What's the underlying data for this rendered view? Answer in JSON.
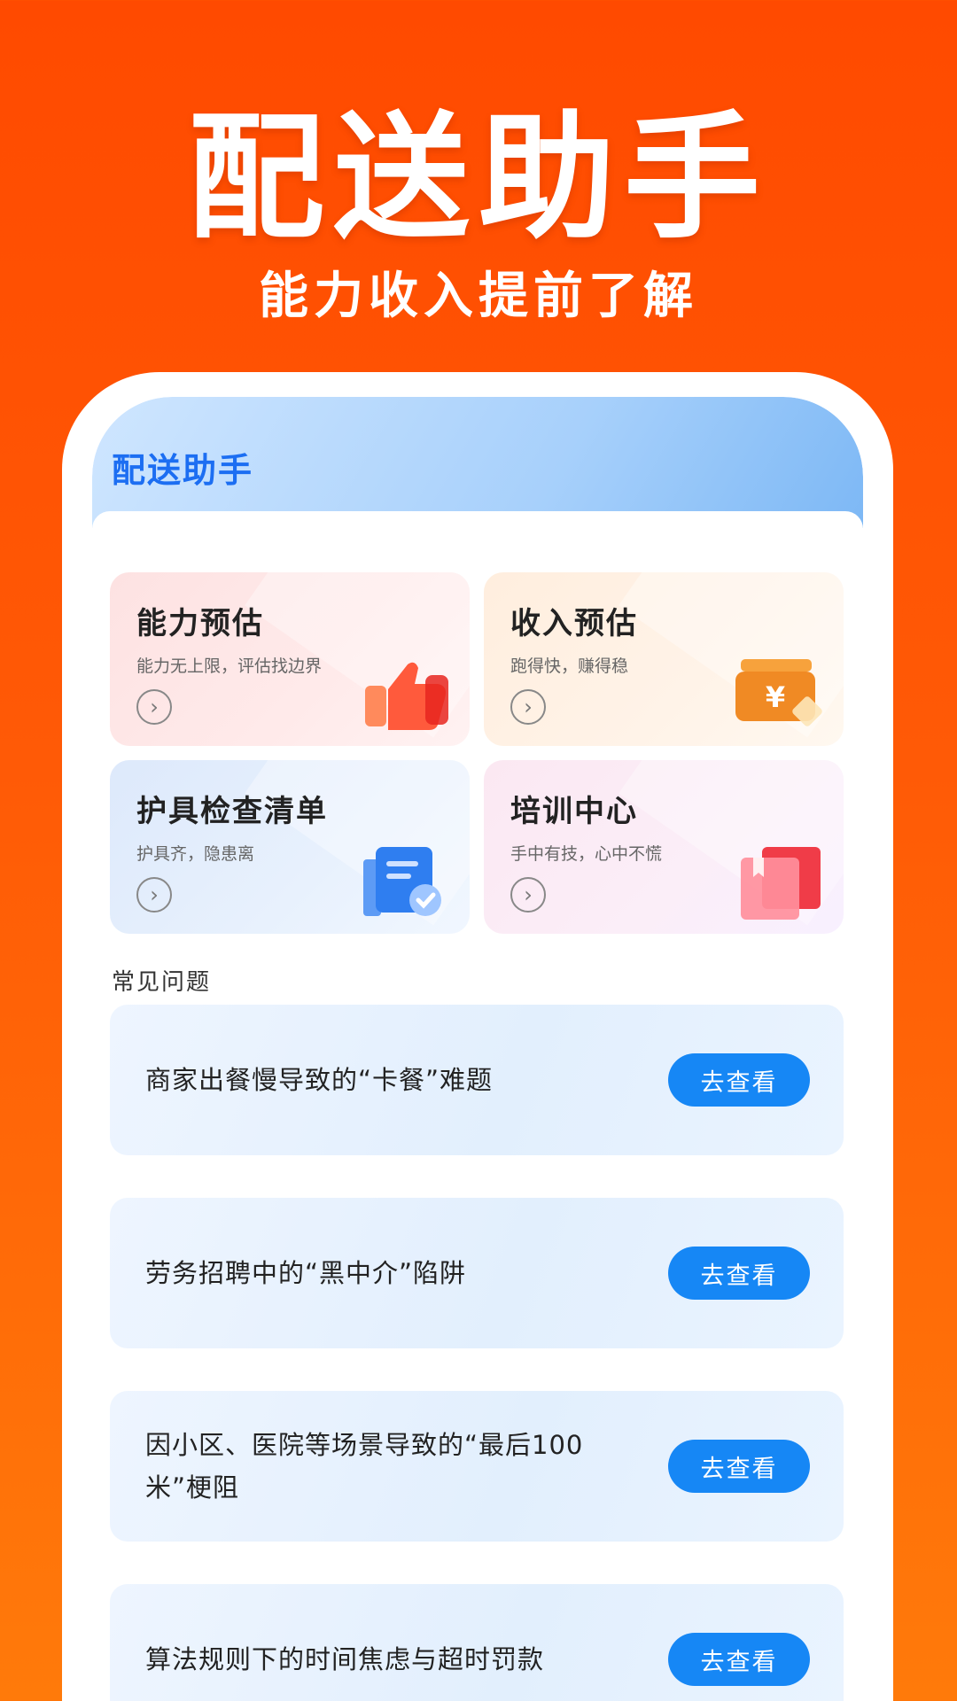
{
  "hero": {
    "title": "配送助手",
    "subtitle": "能力收入提前了解"
  },
  "screen": {
    "title": "配送助手"
  },
  "cards": [
    {
      "title": "能力预估",
      "subtitle": "能力无上限，评估找边界",
      "icon": "thumbs-up-icon",
      "arrow": "›"
    },
    {
      "title": "收入预估",
      "subtitle": "跑得快，赚得稳",
      "icon": "wallet-yuan-icon",
      "arrow": "›"
    },
    {
      "title": "护具检查清单",
      "subtitle": "护具齐，隐患离",
      "icon": "checklist-icon",
      "arrow": "›"
    },
    {
      "title": "培训中心",
      "subtitle": "手中有技，心中不慌",
      "icon": "book-icon",
      "arrow": "›"
    }
  ],
  "faq": {
    "label": "常见问题",
    "items": [
      {
        "text": "商家出餐慢导致的“卡餐”难题",
        "button": "去查看"
      },
      {
        "text": "劳务招聘中的“黑中介”陷阱",
        "button": "去查看"
      },
      {
        "text": "因小区、医院等场景导致的“最后100米”梗阻",
        "button": "去查看"
      },
      {
        "text": "算法规则下的时间焦虑与超时罚款",
        "button": "去查看"
      }
    ]
  },
  "colors": {
    "background": "#ff4a00",
    "accent": "#1687f5",
    "title_blue": "#1c6ef2"
  }
}
